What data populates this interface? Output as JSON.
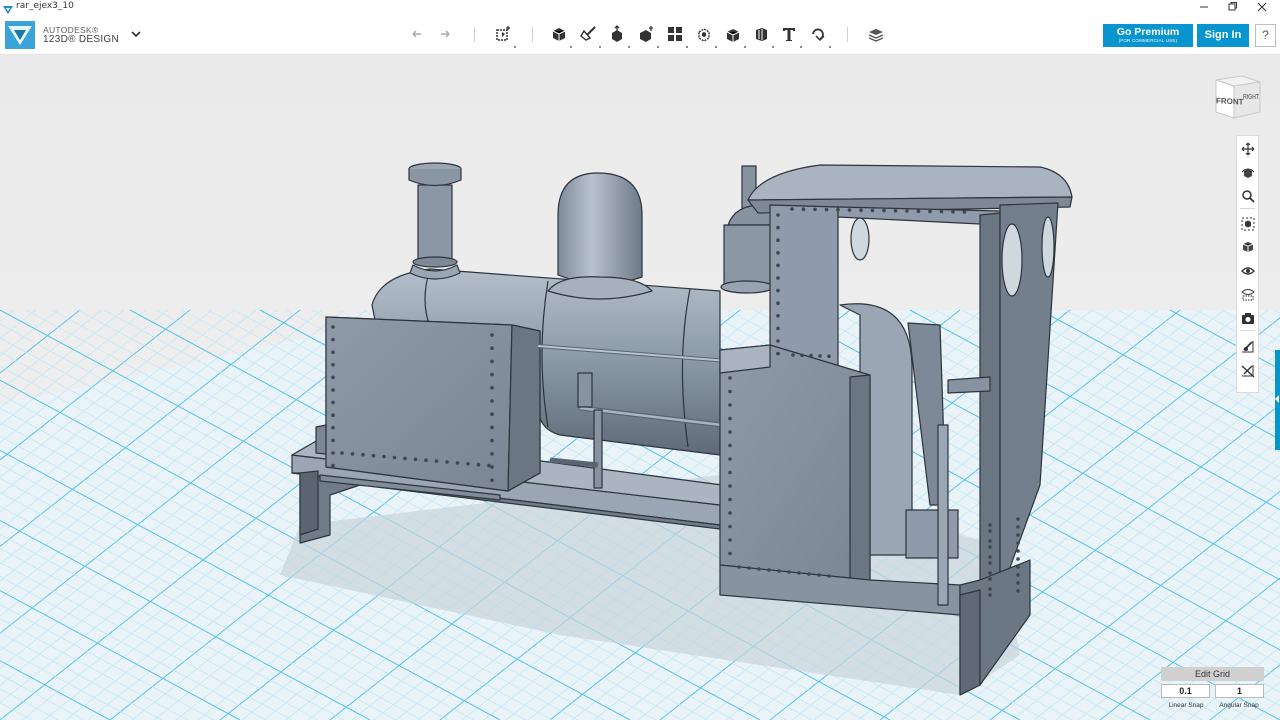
{
  "window": {
    "title": "rar_ejex3_10"
  },
  "brand": {
    "line1": "AUTODESK®",
    "line2": "123D® DESIGN"
  },
  "header": {
    "premium_label": "Go Premium",
    "premium_sub": "(FOR COMMERCIAL USE)",
    "signin_label": "Sign In",
    "help_label": "?"
  },
  "toolbar": {
    "tools": [
      "undo-icon",
      "redo-icon",
      "transform-icon",
      "primitives-icon",
      "sketch-icon",
      "construct-icon",
      "modify-icon",
      "pattern-icon",
      "group-icon",
      "combine-icon",
      "measure-icon",
      "text-icon",
      "snap-icon",
      "materials-icon"
    ]
  },
  "viewcube": {
    "front_label": "FRONT",
    "right_label": "RIGHT"
  },
  "nav": {
    "items": [
      "pan-icon",
      "orbit-icon",
      "zoom-icon",
      "fit-icon",
      "view-icon",
      "eye-icon",
      "materials-view-icon",
      "camera-icon",
      "grid-snap-icon",
      "grid-off-icon"
    ]
  },
  "grid": {
    "edit_label": "Edit Grid",
    "linear_value": "0.1",
    "angular_value": "1",
    "linear_label": "Linear Snap",
    "angular_label": "Angular Snap"
  },
  "colors": {
    "accent": "#0795d0",
    "model": "#8e9aa8",
    "grid_major": "#56c3ec",
    "grid_minor": "#bfe6f6"
  }
}
